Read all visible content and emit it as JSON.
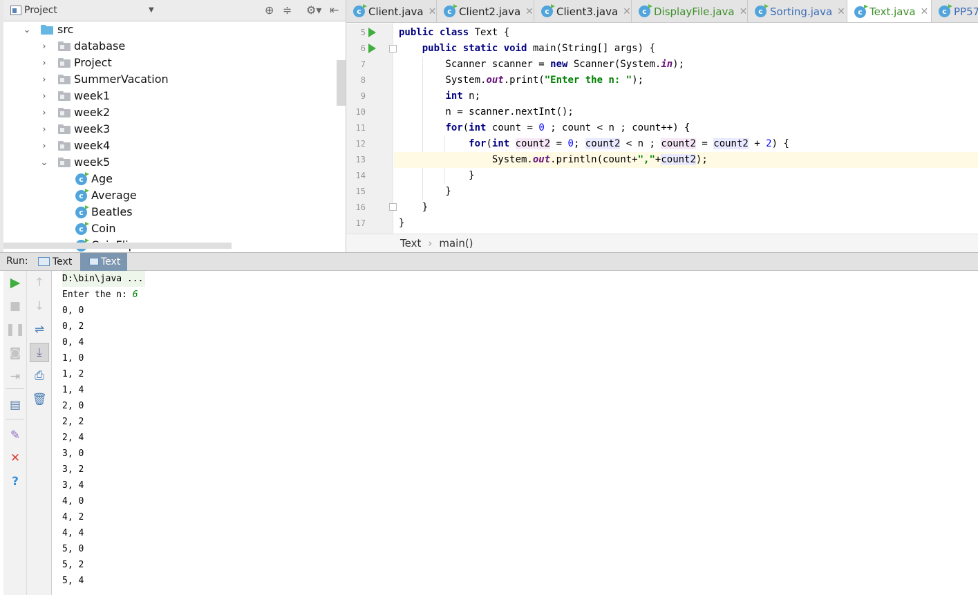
{
  "project_panel": {
    "title": "Project",
    "tree": [
      {
        "label": "src",
        "kind": "src-folder",
        "expanded": true
      },
      {
        "label": "database",
        "kind": "package"
      },
      {
        "label": "Project",
        "kind": "package"
      },
      {
        "label": "SummerVacation",
        "kind": "package"
      },
      {
        "label": "week1",
        "kind": "package"
      },
      {
        "label": "week2",
        "kind": "package"
      },
      {
        "label": "week3",
        "kind": "package"
      },
      {
        "label": "week4",
        "kind": "package"
      },
      {
        "label": "week5",
        "kind": "package",
        "expanded": true
      },
      {
        "label": "Age",
        "kind": "class"
      },
      {
        "label": "Average",
        "kind": "class"
      },
      {
        "label": "Beatles",
        "kind": "class"
      },
      {
        "label": "Coin",
        "kind": "class"
      },
      {
        "label": "CoinFlip",
        "kind": "class"
      }
    ]
  },
  "editor_tabs": [
    {
      "label": "Client.java",
      "color": "#222222"
    },
    {
      "label": "Client2.java",
      "color": "#222222"
    },
    {
      "label": "Client3.java",
      "color": "#222222"
    },
    {
      "label": "DisplayFile.java",
      "color": "#3d8f2a"
    },
    {
      "label": "Sorting.java",
      "color": "#3b6cb7"
    },
    {
      "label": "Text.java",
      "color": "#3d8f2a",
      "active": true
    },
    {
      "label": "PP57",
      "color": "#3b6cb7"
    }
  ],
  "code": {
    "line_numbers": [
      "5",
      "6",
      "7",
      "8",
      "9",
      "10",
      "11",
      "12",
      "13",
      "14",
      "15",
      "16",
      "17"
    ],
    "lines": [
      "public class Text {",
      "    public static void main(String[] args) {",
      "        Scanner scanner = new Scanner(System.in);",
      "        System.out.print(\"Enter the n: \");",
      "        int n;",
      "        n = scanner.nextInt();",
      "        for(int count = 0 ; count < n ; count++) {",
      "            for(int count2 = 0; count2 < n ; count2 = count2 + 2) {",
      "                System.out.println(count+\",\"+count2);",
      "            }",
      "        }",
      "    }",
      "}"
    ],
    "current_line": "13"
  },
  "breadcrumb": {
    "items": [
      "Text",
      "main()"
    ],
    "separator": "›"
  },
  "run_panel": {
    "label": "Run:",
    "tabs": [
      {
        "label": "Text"
      },
      {
        "label": "Text",
        "active": true
      }
    ]
  },
  "console": {
    "command": "D:\\bin\\java ...",
    "prompt": "Enter the n: ",
    "input": "6",
    "output": [
      "0, 0",
      "0, 2",
      "0, 4",
      "1, 0",
      "1, 2",
      "1, 4",
      "2, 0",
      "2, 2",
      "2, 4",
      "3, 0",
      "3, 2",
      "3, 4",
      "4, 0",
      "4, 2",
      "4, 4",
      "5, 0",
      "5, 2",
      "5, 4"
    ]
  },
  "icons": {
    "project_header": [
      "project-view-icon",
      "dropdown-icon",
      "target-icon",
      "collapse-icon",
      "gear-icon",
      "hide-icon"
    ],
    "run_toolbar_left": [
      "rerun-icon",
      "stop-icon",
      "pause-icon",
      "dump-threads-icon",
      "exit-icon",
      "layout-icon",
      "pin-icon",
      "close-icon",
      "help-icon"
    ],
    "run_toolbar_right": [
      "up-arrow-icon",
      "down-arrow-icon",
      "soft-wrap-icon",
      "scroll-to-end-icon",
      "print-icon",
      "trash-icon"
    ]
  },
  "colors": {
    "keyword": "#000080",
    "string": "#008000",
    "static_field": "#660e7a",
    "number": "#0000ff",
    "current_line_bg": "#fffae3",
    "run_green": "#3fae3f"
  }
}
